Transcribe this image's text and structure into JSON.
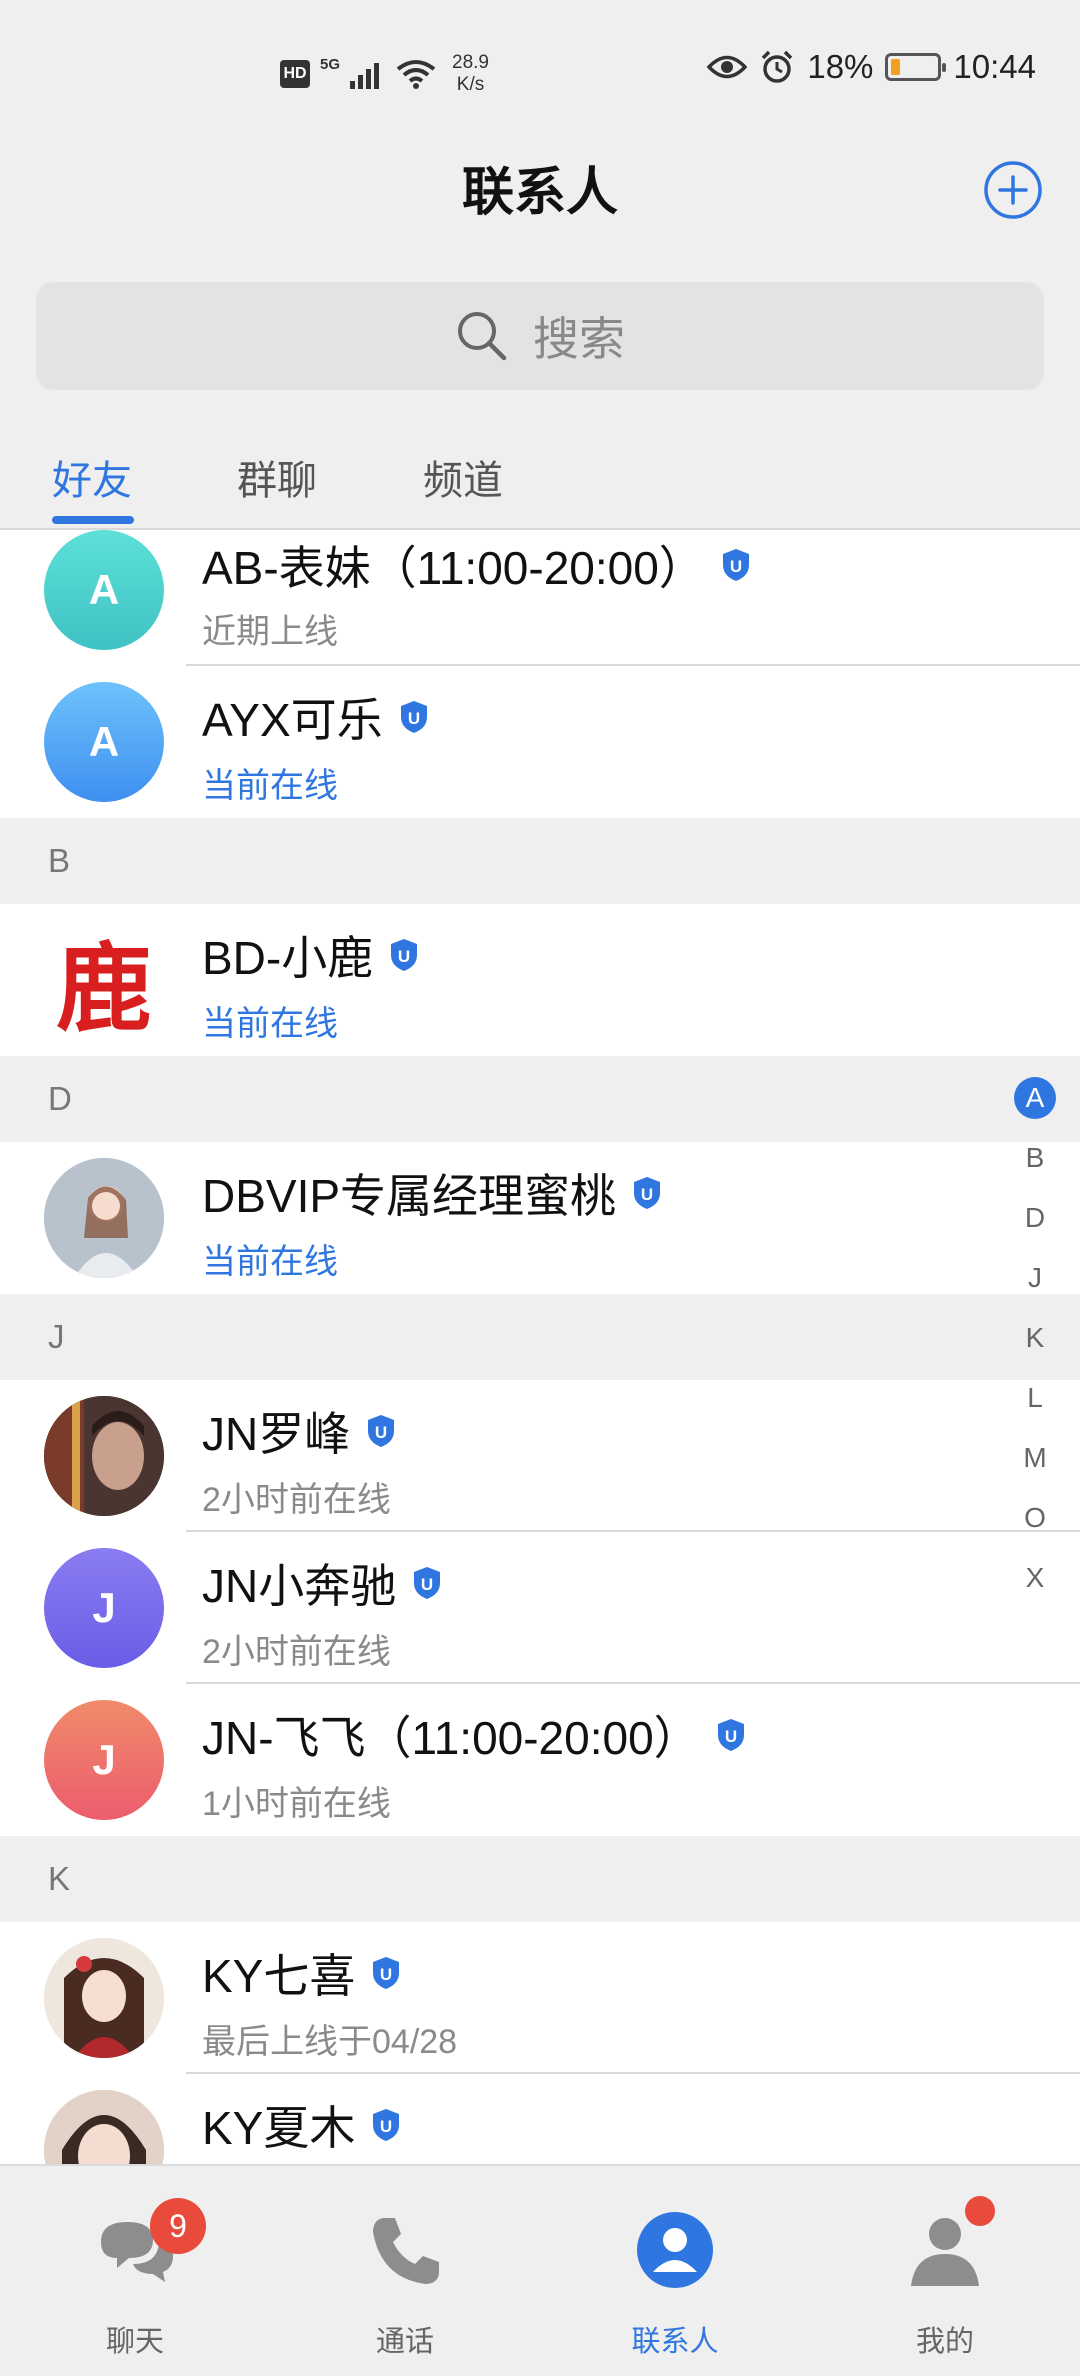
{
  "status_bar": {
    "hd": "HD",
    "network": "5G",
    "speed_value": "28.9",
    "speed_unit": "K/s",
    "battery": "18%",
    "battery_level": 0.18,
    "time": "10:44"
  },
  "header": {
    "title": "联系人"
  },
  "search": {
    "placeholder": "搜索"
  },
  "tabs": [
    {
      "label": "好友",
      "active": true
    },
    {
      "label": "群聊",
      "active": false
    },
    {
      "label": "频道",
      "active": false
    }
  ],
  "contacts": {
    "ab": {
      "initial": "A",
      "name": "AB-表妹（11:00-20:00）",
      "status": "近期上线"
    },
    "ayx": {
      "initial": "A",
      "name": "AYX可乐",
      "status": "当前在线"
    },
    "section_b": "B",
    "bd": {
      "logo_text": "鹿",
      "name": "BD-小鹿",
      "status": "当前在线"
    },
    "section_d": "D",
    "dbvip": {
      "name": "DBVIP专属经理蜜桃",
      "status": "当前在线"
    },
    "section_j": "J",
    "jn_luofeng": {
      "name": "JN罗峰",
      "status": "2小时前在线"
    },
    "jn_benchi": {
      "initial": "J",
      "name": "JN小奔驰",
      "status": "2小时前在线"
    },
    "jn_feifei": {
      "initial": "J",
      "name": "JN-飞飞（11:00-20:00）",
      "status": "1小时前在线"
    },
    "section_k": "K",
    "ky_qixi": {
      "name": "KY七喜",
      "status": "最后上线于04/28"
    },
    "ky_xiamu": {
      "name": "KY夏木"
    }
  },
  "alpha_index": [
    "A",
    "B",
    "D",
    "J",
    "K",
    "L",
    "M",
    "O",
    "X"
  ],
  "alpha_active": "A",
  "verified_badge_letter": "U",
  "bottom_nav": [
    {
      "label": "聊天",
      "icon": "chat-bubble-icon",
      "badge": "9"
    },
    {
      "label": "通话",
      "icon": "phone-icon"
    },
    {
      "label": "联系人",
      "icon": "contacts-icon",
      "active": true
    },
    {
      "label": "我的",
      "icon": "profile-icon",
      "dot": true
    }
  ],
  "colors": {
    "accent": "#2f76e0",
    "badge_red": "#e84a3c",
    "online": "#2f76e0"
  }
}
